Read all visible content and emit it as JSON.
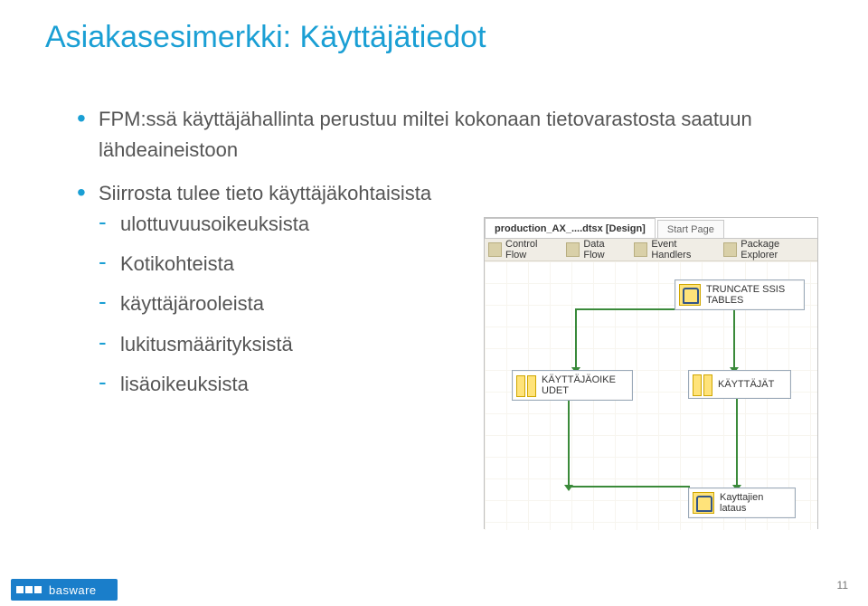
{
  "title": "Asiakasesimerkki: Käyttäjätiedot",
  "bullets": [
    {
      "text": "FPM:ssä käyttäjähallinta perustuu miltei kokonaan tietovarastosta saatuun lähdeaineistoon",
      "children": []
    },
    {
      "text": "Siirrosta tulee tieto käyttäjäkohtaisista",
      "children": [
        "ulottuvuusoikeuksista",
        "Kotikohteista",
        "käyttäjärooleista",
        "lukitusmäärityksistä",
        "lisäoikeuksista"
      ]
    }
  ],
  "mock": {
    "tab_active": "production_AX_....dtsx [Design]",
    "tab_inactive": "Start Page",
    "toolbar": {
      "control_flow": "Control Flow",
      "data_flow": "Data Flow",
      "event_handlers": "Event Handlers",
      "package_explorer": "Package Explorer"
    },
    "nodes": {
      "truncate": "TRUNCATE SSIS\nTABLES",
      "oikeudet": "KÄYTTÄJÄOIKE\nUDET",
      "kayttajat": "KÄYTTÄJÄT",
      "lataus": "Kayttajien\nlataus"
    }
  },
  "logo_text": "basware",
  "page_number": "11"
}
